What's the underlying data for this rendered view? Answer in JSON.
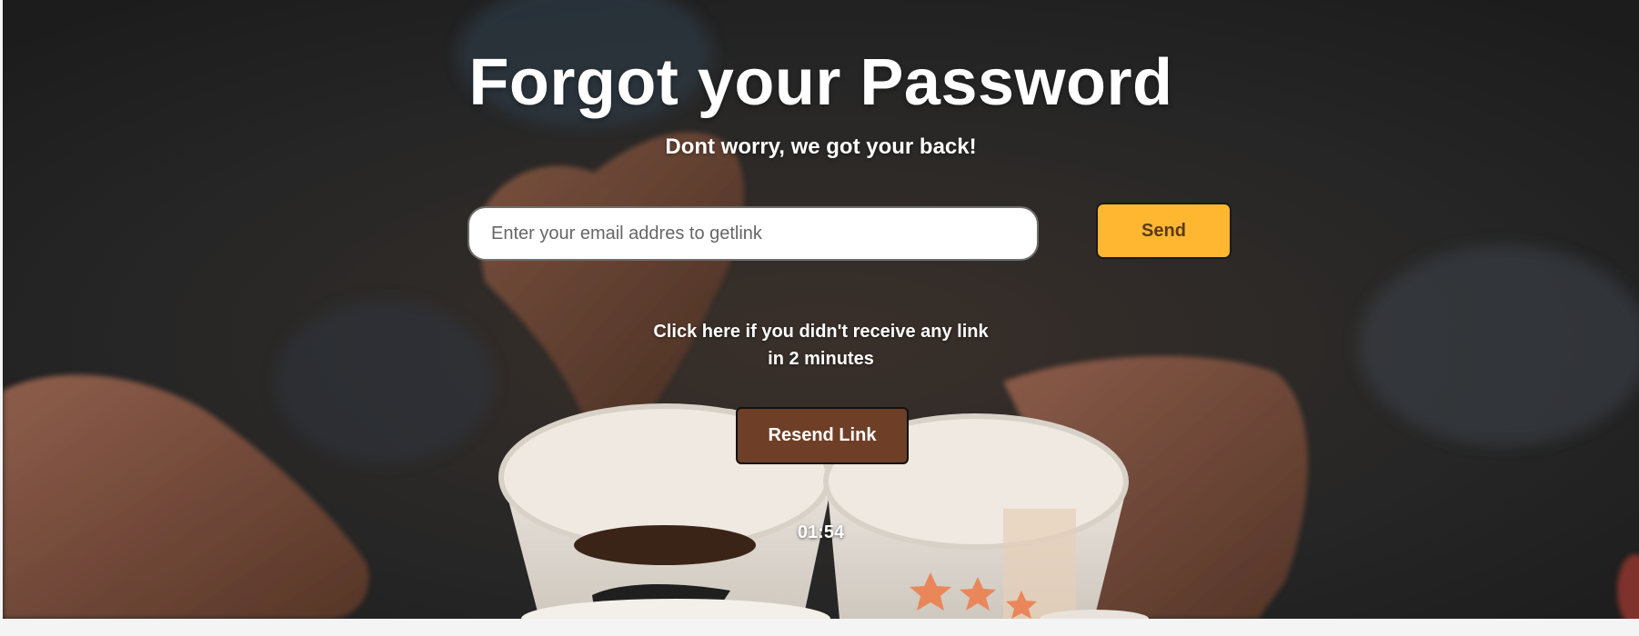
{
  "page": {
    "title": "Forgot your Password",
    "subtitle": "Dont worry, we got your back!"
  },
  "form": {
    "email_placeholder": "Enter your email addres to getlink",
    "email_value": "",
    "send_label": "Send"
  },
  "resend": {
    "hint_line1": "Click here if you didn't receive any link",
    "hint_line2": "in 2 minutes",
    "button_label": "Resend Link",
    "timer": "01:54"
  },
  "background": {
    "image": "coffee-cups-photo"
  },
  "colors": {
    "send_button": "#ffb731",
    "resend_button": "#6e3f26",
    "text": "#ffffff"
  }
}
